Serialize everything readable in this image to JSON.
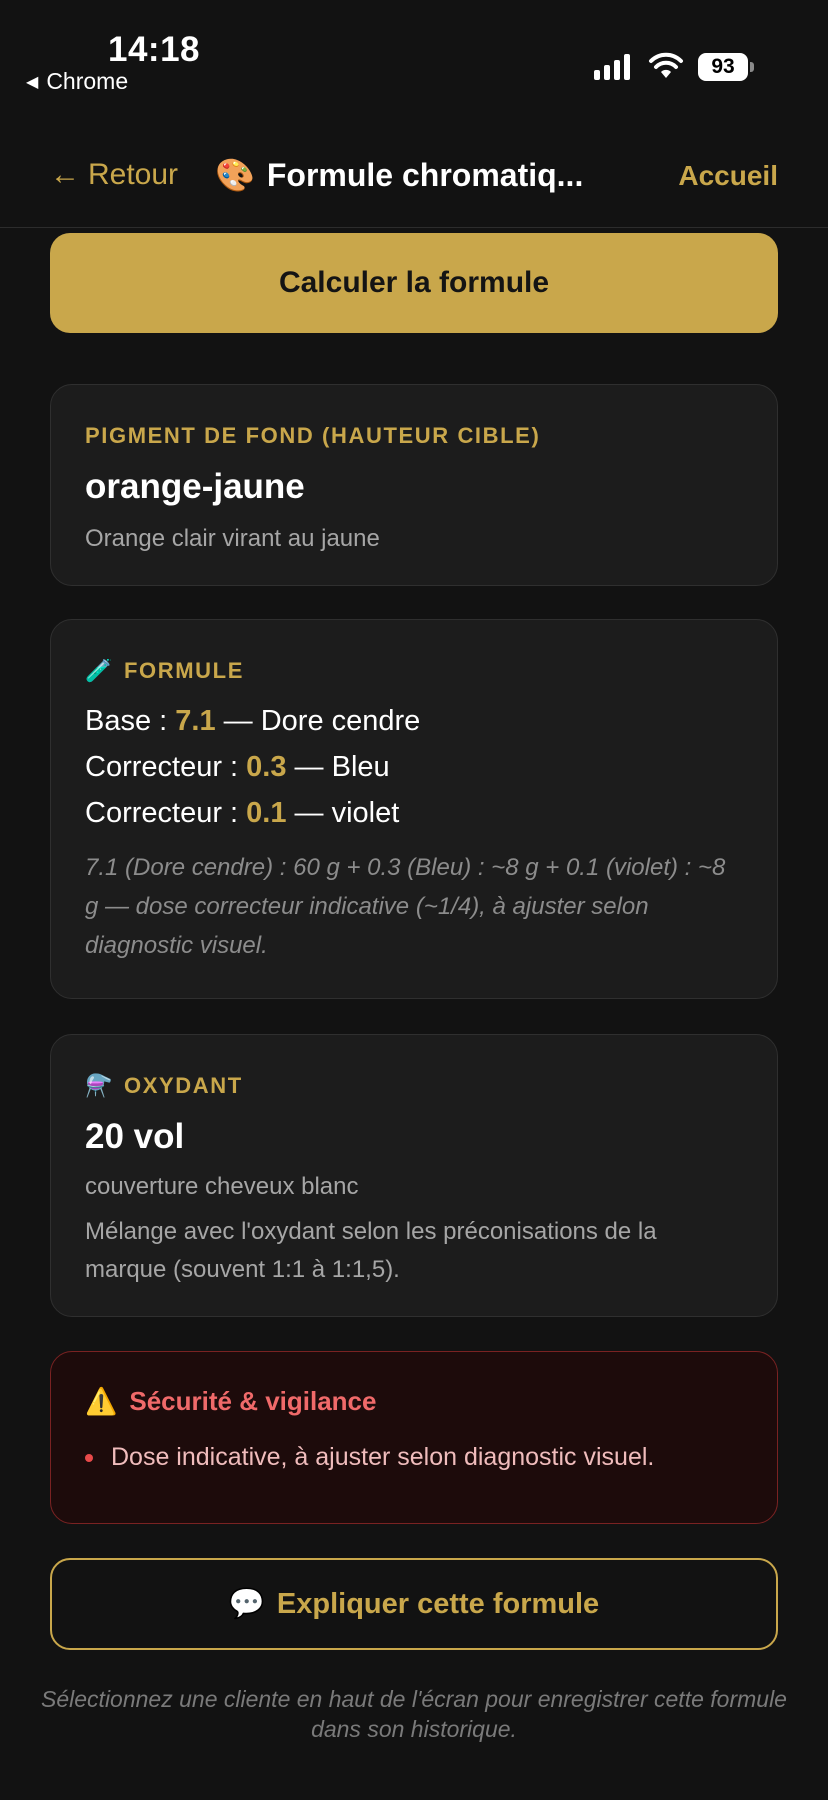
{
  "status_bar": {
    "time": "14:18",
    "back_app": "Chrome",
    "battery": "93"
  },
  "nav": {
    "back_label": "Retour",
    "title_icon": "🎨",
    "title": "Formule chromatiq...",
    "home_label": "Accueil"
  },
  "actions": {
    "calculate_label": "Calculer la formule",
    "explain_icon": "💬",
    "explain_label": "Expliquer cette formule"
  },
  "pigment_card": {
    "label": "PIGMENT DE FOND (HAUTEUR CIBLE)",
    "value": "orange-jaune",
    "description": "Orange clair virant au jaune"
  },
  "formula_card": {
    "icon": "🧪",
    "label": "FORMULE",
    "lines": [
      {
        "prefix": "Base : ",
        "value": "7.1",
        "suffix": " — Dore cendre"
      },
      {
        "prefix": "Correcteur : ",
        "value": "0.3",
        "suffix": " — Bleu"
      },
      {
        "prefix": "Correcteur : ",
        "value": "0.1",
        "suffix": " — violet"
      }
    ],
    "note": "7.1 (Dore cendre) : 60 g  +  0.3 (Bleu) : ~8 g  +  0.1 (violet) : ~8 g  — dose correcteur indicative (~1/4), à ajuster selon diagnostic visuel."
  },
  "oxidant_card": {
    "icon": "⚗️",
    "label": "OXYDANT",
    "value": "20 vol",
    "subtitle": "couverture cheveux blanc",
    "description": "Mélange avec l'oxydant selon les préconisations de la marque (souvent 1:1 à 1:1,5)."
  },
  "safety_card": {
    "icon": "⚠️",
    "title": "Sécurité & vigilance",
    "items": [
      "Dose indicative, à ajuster selon diagnostic visuel."
    ]
  },
  "footer": {
    "note": "Sélectionnez une cliente en haut de l'écran pour enregistrer cette formule dans son historique."
  },
  "colors": {
    "accent": "#c9a74b",
    "background": "#121212",
    "card": "#1c1c1c",
    "danger": "#f06a6a"
  }
}
